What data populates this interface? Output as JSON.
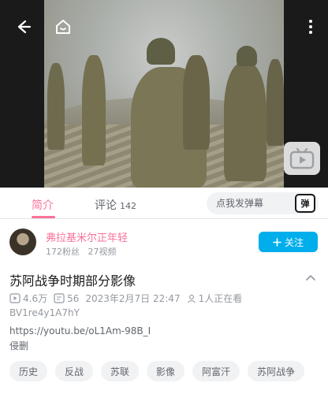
{
  "video": {
    "back_icon": "back-arrow-icon",
    "home_icon": "home-icon",
    "more_icon": "more-vertical-icon",
    "play_badge_icon": "tv-play-icon"
  },
  "tabs": {
    "intro_label": "简介",
    "comments_label": "评论",
    "comments_count": "142",
    "danmaku_placeholder": "点我发弹幕",
    "danmaku_icon_label": "弹"
  },
  "uploader": {
    "name": "弗拉基米尔正年轻",
    "fans": "172粉丝",
    "videos": "27视频",
    "follow_label": "关注"
  },
  "video_info": {
    "title": "苏阿战争时期部分影像",
    "views": "4.6万",
    "danmaku": "56",
    "date": "2023年2月7日 22:47",
    "watching": "1人正在看",
    "bvid": "BV1re4y1A7hY",
    "desc_link": "https://youtu.be/oL1Am-98B_I",
    "desc_note": "侵删"
  },
  "tags": [
    "历史",
    "反战",
    "苏联",
    "影像",
    "阿富汗",
    "苏阿战争"
  ],
  "colors": {
    "accent_pink": "#fb7299",
    "follow_blue": "#00aeec"
  }
}
